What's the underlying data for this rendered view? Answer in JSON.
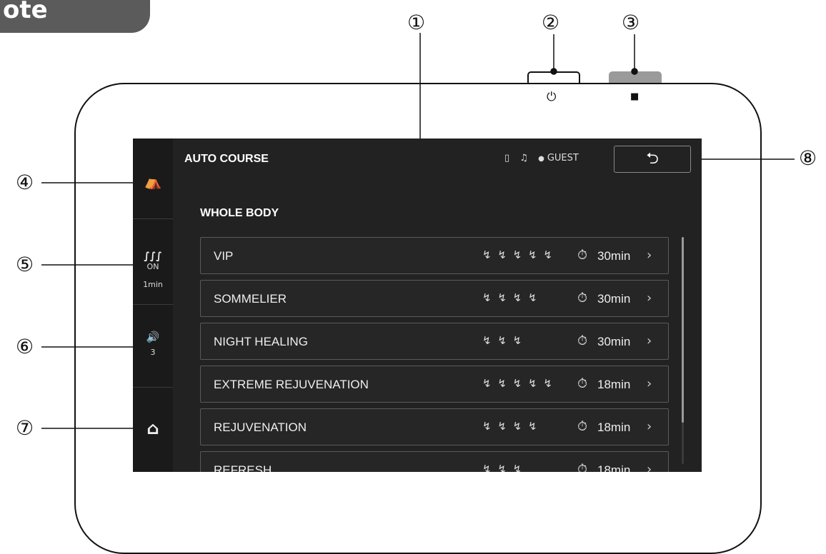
{
  "header_tag": "ote control",
  "callouts": {
    "c1": "①",
    "c2": "②",
    "c3": "③",
    "c4": "④",
    "c5": "⑤",
    "c6": "⑥",
    "c7": "⑦",
    "c8": "⑧"
  },
  "hardware": {
    "power_symbol": "⏻",
    "stop_symbol": "■"
  },
  "screen": {
    "title": "AUTO COURSE",
    "status": {
      "phone_icon": "▯",
      "music_icon": "♫",
      "user_icon": "●",
      "user_label": "GUEST"
    },
    "back_button": "⮌",
    "section_title": "WHOLE BODY",
    "rail": {
      "chair_icon": "⛺",
      "heat_icon": "∫∫∫",
      "heat_state": "ON",
      "heat_time": "1min",
      "volume_icon": "🔊",
      "volume_level": "3",
      "home_icon": "⌂"
    },
    "courses": [
      {
        "name": "VIP",
        "intensity": 5,
        "time": "30min"
      },
      {
        "name": "SOMMELIER",
        "intensity": 4,
        "time": "30min"
      },
      {
        "name": "NIGHT HEALING",
        "intensity": 3,
        "time": "30min"
      },
      {
        "name": "EXTREME REJUVENATION",
        "intensity": 5,
        "time": "18min"
      },
      {
        "name": "REJUVENATION",
        "intensity": 4,
        "time": "18min"
      },
      {
        "name": "REFRESH",
        "intensity": 3,
        "time": "18min"
      }
    ],
    "timer_icon": "⏱",
    "chevron": "›",
    "intensity_glyph": "↯"
  }
}
